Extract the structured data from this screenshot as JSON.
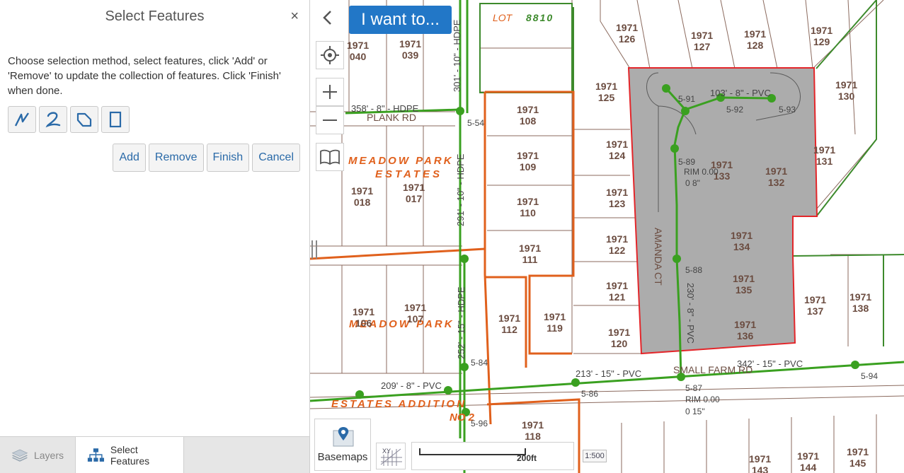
{
  "panel": {
    "title": "Select Features",
    "close_glyph": "×",
    "instructions": "Choose selection method, select features, click 'Add' or 'Remove' to update the collection of features. Click 'Finish' when done.",
    "tools": [
      {
        "name": "polyline-tool",
        "icon": "polyline-icon"
      },
      {
        "name": "freehand-tool",
        "icon": "freehand-icon"
      },
      {
        "name": "polygon-tool",
        "icon": "polygon-icon"
      },
      {
        "name": "rectangle-tool",
        "icon": "rectangle-icon"
      }
    ],
    "buttons": {
      "add": "Add",
      "remove": "Remove",
      "finish": "Finish",
      "cancel": "Cancel"
    }
  },
  "tabs": [
    {
      "label": "Layers",
      "icon": "layers-icon",
      "active": false
    },
    {
      "label": "Select Features",
      "icon": "hierarchy-icon",
      "active": true
    }
  ],
  "map": {
    "i_want_to": "I want to...",
    "basemaps_label": "Basemaps",
    "scale_label": "200ft",
    "scale_input": "1:500",
    "colors": {
      "parcel": "#8b6a5e",
      "sewer": "#3aa020",
      "orange": "#e0601c",
      "selection": "#e3262a",
      "selection_fill": "#9e9e9e"
    },
    "subdivision_labels": [
      "MEADOW PARK",
      "ESTATES",
      "MEADOW PARK",
      "ESTATES ADDITION",
      "NO 2"
    ],
    "roads": [
      "PLANK RD",
      "SMALL FARM RD",
      "AMANDA CT"
    ],
    "parcels": [
      {
        "line1": "1971",
        "line2": "040"
      },
      {
        "line1": "1971",
        "line2": "039"
      },
      {
        "line1": "1971",
        "line2": "126"
      },
      {
        "line1": "1971",
        "line2": "127"
      },
      {
        "line1": "1971",
        "line2": "128"
      },
      {
        "line1": "1971",
        "line2": "129"
      },
      {
        "line1": "1971",
        "line2": "125"
      },
      {
        "line1": "1971",
        "line2": "130"
      },
      {
        "line1": "1971",
        "line2": "108"
      },
      {
        "line1": "1971",
        "line2": "109"
      },
      {
        "line1": "1971",
        "line2": "110"
      },
      {
        "line1": "1971",
        "line2": "124"
      },
      {
        "line1": "1971",
        "line2": "123"
      },
      {
        "line1": "1971",
        "line2": "131"
      },
      {
        "line1": "1971",
        "line2": "133"
      },
      {
        "line1": "1971",
        "line2": "132"
      },
      {
        "line1": "1971",
        "line2": "018"
      },
      {
        "line1": "1971",
        "line2": "017"
      },
      {
        "line1": "1971",
        "line2": "111"
      },
      {
        "line1": "1971",
        "line2": "122"
      },
      {
        "line1": "1971",
        "line2": "134"
      },
      {
        "line1": "1971",
        "line2": "121"
      },
      {
        "line1": "1971",
        "line2": "135"
      },
      {
        "line1": "1971",
        "line2": "137"
      },
      {
        "line1": "1971",
        "line2": "138"
      },
      {
        "line1": "1971",
        "line2": "106"
      },
      {
        "line1": "1971",
        "line2": "107"
      },
      {
        "line1": "1971",
        "line2": "112"
      },
      {
        "line1": "1971",
        "line2": "119"
      },
      {
        "line1": "1971",
        "line2": "120"
      },
      {
        "line1": "1971",
        "line2": "136"
      },
      {
        "line1": "1971",
        "line2": "118"
      },
      {
        "line1": "1971",
        "line2": "143"
      },
      {
        "line1": "1971",
        "line2": "144"
      },
      {
        "line1": "1971",
        "line2": "145"
      }
    ],
    "pipe_labels": [
      "103' - 8\" - PVC",
      "358' - 8\" - HDPE",
      "301' - 10\" - HDPE",
      "291' - 10\" - HDPE",
      "252' - 15\" - HDPE",
      "213' - 15\" - PVC",
      "342' - 15\" - PVC",
      "230' - 8\" - PVC",
      "209' - 8\" - PVC"
    ],
    "manholes": [
      "5-91",
      "5-92",
      "5-93",
      "5-89",
      "5-88",
      "5-87",
      "5-86",
      "5-94",
      "5-54",
      "5-84",
      "5-96"
    ],
    "misc_text": [
      "LOT",
      "8810",
      "RIM 0.00",
      "0 8\"",
      "0 15\""
    ]
  }
}
